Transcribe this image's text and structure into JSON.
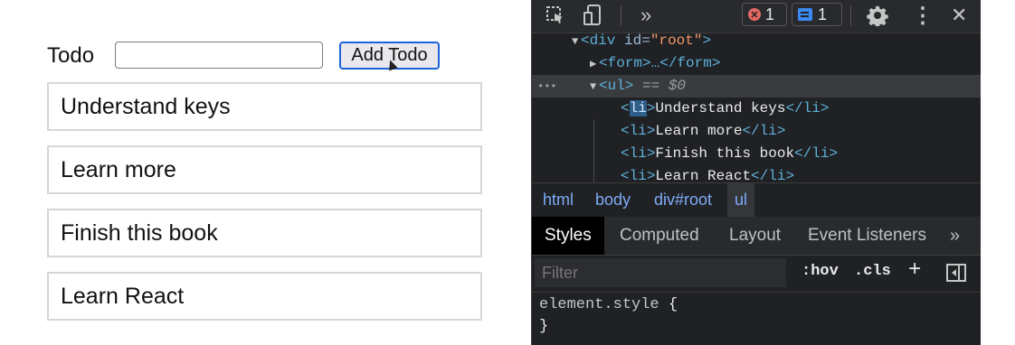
{
  "app": {
    "label": "Todo",
    "input_value": "",
    "button_label": "Add Todo",
    "todos": [
      "Understand keys",
      "Learn more",
      "Finish this book",
      "Learn React"
    ]
  },
  "devtools": {
    "toolbar": {
      "more_tools": "»",
      "errors_count": "1",
      "messages_count": "1",
      "kebab": "⋮",
      "close": "✕"
    },
    "dom": {
      "ellipsis_marker": "•••",
      "div_open_tag": "<div",
      "div_attr_name": "id=",
      "div_attr_value": "\"root\"",
      "div_close_bracket": ">",
      "form_collapsed": "<form>…</form>",
      "ul_tag": "<ul>",
      "ul_ref": "== $0",
      "li_items": [
        "Understand keys",
        "Learn more",
        "Finish this book",
        "Learn React"
      ],
      "li_open_pre": "<",
      "li_tag_name": "li",
      "li_open_post": ">",
      "li_close": "</li>"
    },
    "breadcrumbs": [
      "html",
      "body",
      "div#root",
      "ul"
    ],
    "tabs": [
      "Styles",
      "Computed",
      "Layout",
      "Event Listeners"
    ],
    "tabs_more": "»",
    "filter_placeholder": "Filter",
    "hov": ":hov",
    "cls": ".cls",
    "plus": "+",
    "element_style_selector": "element.style",
    "open_brace": "{",
    "close_brace": "}"
  },
  "colors": {
    "accent_button_border": "#1a63d8",
    "devtools_bg": "#202124",
    "tag_color": "#5db0d7",
    "attr_value_color": "#f29766"
  }
}
